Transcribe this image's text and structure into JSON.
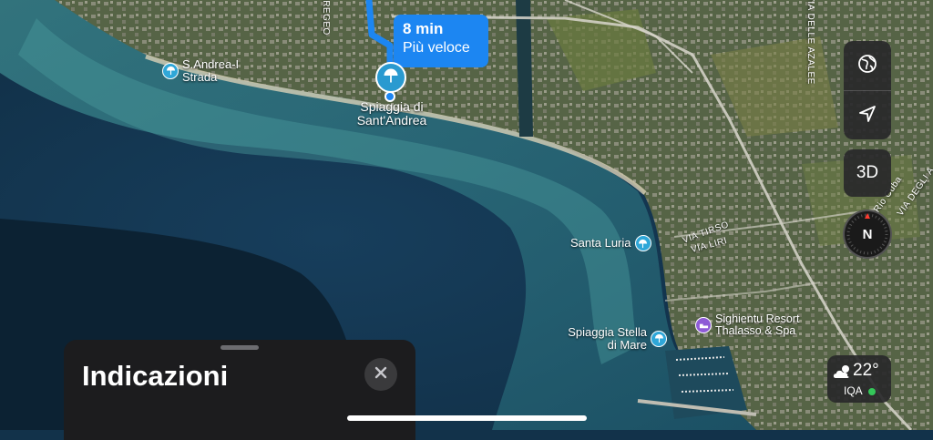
{
  "route": {
    "time": "8 min",
    "label": "Più veloce",
    "color": "#1c86f2"
  },
  "destination": {
    "name": "Spiaggia di Sant'Andrea",
    "icon": "beach-umbrella-icon"
  },
  "pois": [
    {
      "name": "S.Andrea-I Strada",
      "icon": "beach-umbrella-icon"
    },
    {
      "name": "Santa Luria",
      "icon": "beach-umbrella-icon"
    },
    {
      "name": "Spiaggia Stella di Mare",
      "icon": "beach-umbrella-icon"
    },
    {
      "name": "Sighientu Resort Thalasso & Spa",
      "icon": "bed-icon"
    }
  ],
  "roads": [
    "VIA TIRSO",
    "VIA LIRI",
    "VIA DELLE AZALEE",
    "REGEO",
    "VIA DEGLI A",
    "Rio Cuba"
  ],
  "controls": {
    "globe": "globe-icon",
    "location": "location-arrow-icon",
    "view_3d": "3D",
    "compass": "N"
  },
  "weather": {
    "temperature": "22°",
    "aqi_label": "IQA",
    "aqi_color": "#34c759",
    "icon": "partly-cloudy-icon"
  },
  "sheet": {
    "title": "Indicazioni",
    "close_icon": "close-icon"
  }
}
